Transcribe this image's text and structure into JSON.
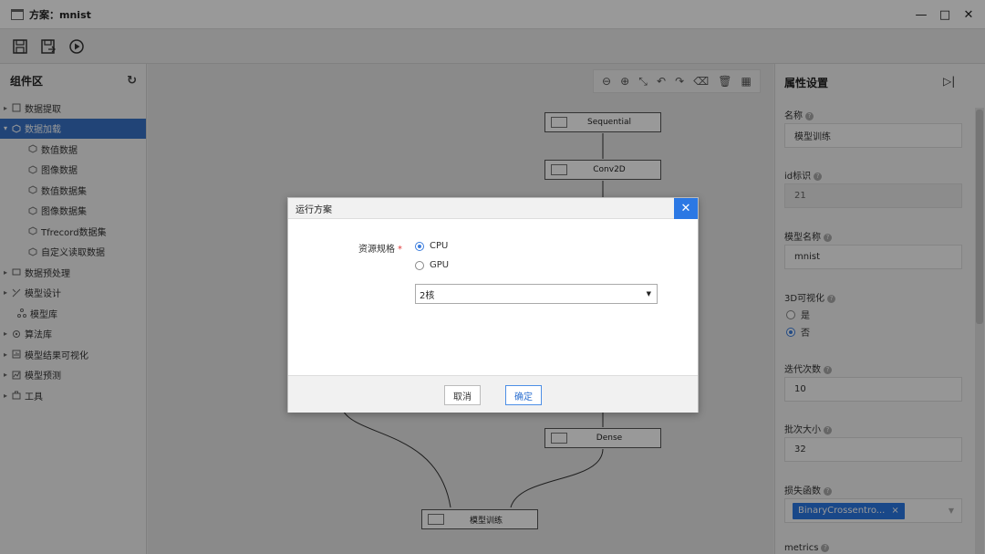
{
  "window": {
    "title": "方案：mnist",
    "minimize": "—",
    "maximize": "□",
    "close": "✕"
  },
  "toolbar": {
    "icons": [
      "save-icon",
      "save-as-icon",
      "run-icon"
    ]
  },
  "sidebar": {
    "title": "组件区",
    "items": [
      {
        "label": "数据提取",
        "arrow": "▸",
        "level": 0,
        "active": false
      },
      {
        "label": "数据加载",
        "arrow": "▾",
        "level": 0,
        "active": true
      },
      {
        "label": "数值数据",
        "level": 1
      },
      {
        "label": "图像数据",
        "level": 1
      },
      {
        "label": "数值数据集",
        "level": 1
      },
      {
        "label": "图像数据集",
        "level": 1
      },
      {
        "label": "Tfrecord数据集",
        "level": 1
      },
      {
        "label": "自定义读取数据",
        "level": 1
      },
      {
        "label": "数据预处理",
        "arrow": "▸",
        "level": 0
      },
      {
        "label": "模型设计",
        "arrow": "▸",
        "level": 0
      },
      {
        "label": "模型库",
        "arrow": "",
        "level": 0
      },
      {
        "label": "算法库",
        "arrow": "▸",
        "level": 0
      },
      {
        "label": "模型结果可视化",
        "arrow": "▸",
        "level": 0
      },
      {
        "label": "模型预测",
        "arrow": "▸",
        "level": 0
      },
      {
        "label": "工具",
        "arrow": "▸",
        "level": 0
      }
    ]
  },
  "canvas": {
    "nodes": [
      "Sequential",
      "Conv2D",
      "Dense",
      "模型训练"
    ]
  },
  "properties": {
    "title": "属性设置",
    "name_label": "名称",
    "name_value": "模型训练",
    "id_label": "id标识",
    "id_value": "21",
    "model_name_label": "模型名称",
    "model_name_value": "mnist",
    "viz3d_label": "3D可视化",
    "viz3d_yes": "是",
    "viz3d_no": "否",
    "epochs_label": "迭代次数",
    "epochs_value": "10",
    "batch_label": "批次大小",
    "batch_value": "32",
    "loss_label": "损失函数",
    "loss_value": "BinaryCrossentro...",
    "metrics_label": "metrics"
  },
  "dialog": {
    "title": "运行方案",
    "resource_label": "资源规格",
    "required_mark": "*",
    "option_cpu": "CPU",
    "option_gpu": "GPU",
    "selected": "CPU",
    "cores_value": "2核",
    "cancel": "取消",
    "confirm": "确定"
  },
  "colors": {
    "accent": "#2b78e4",
    "active_row": "#3772c7",
    "required": "#e03a3a"
  }
}
